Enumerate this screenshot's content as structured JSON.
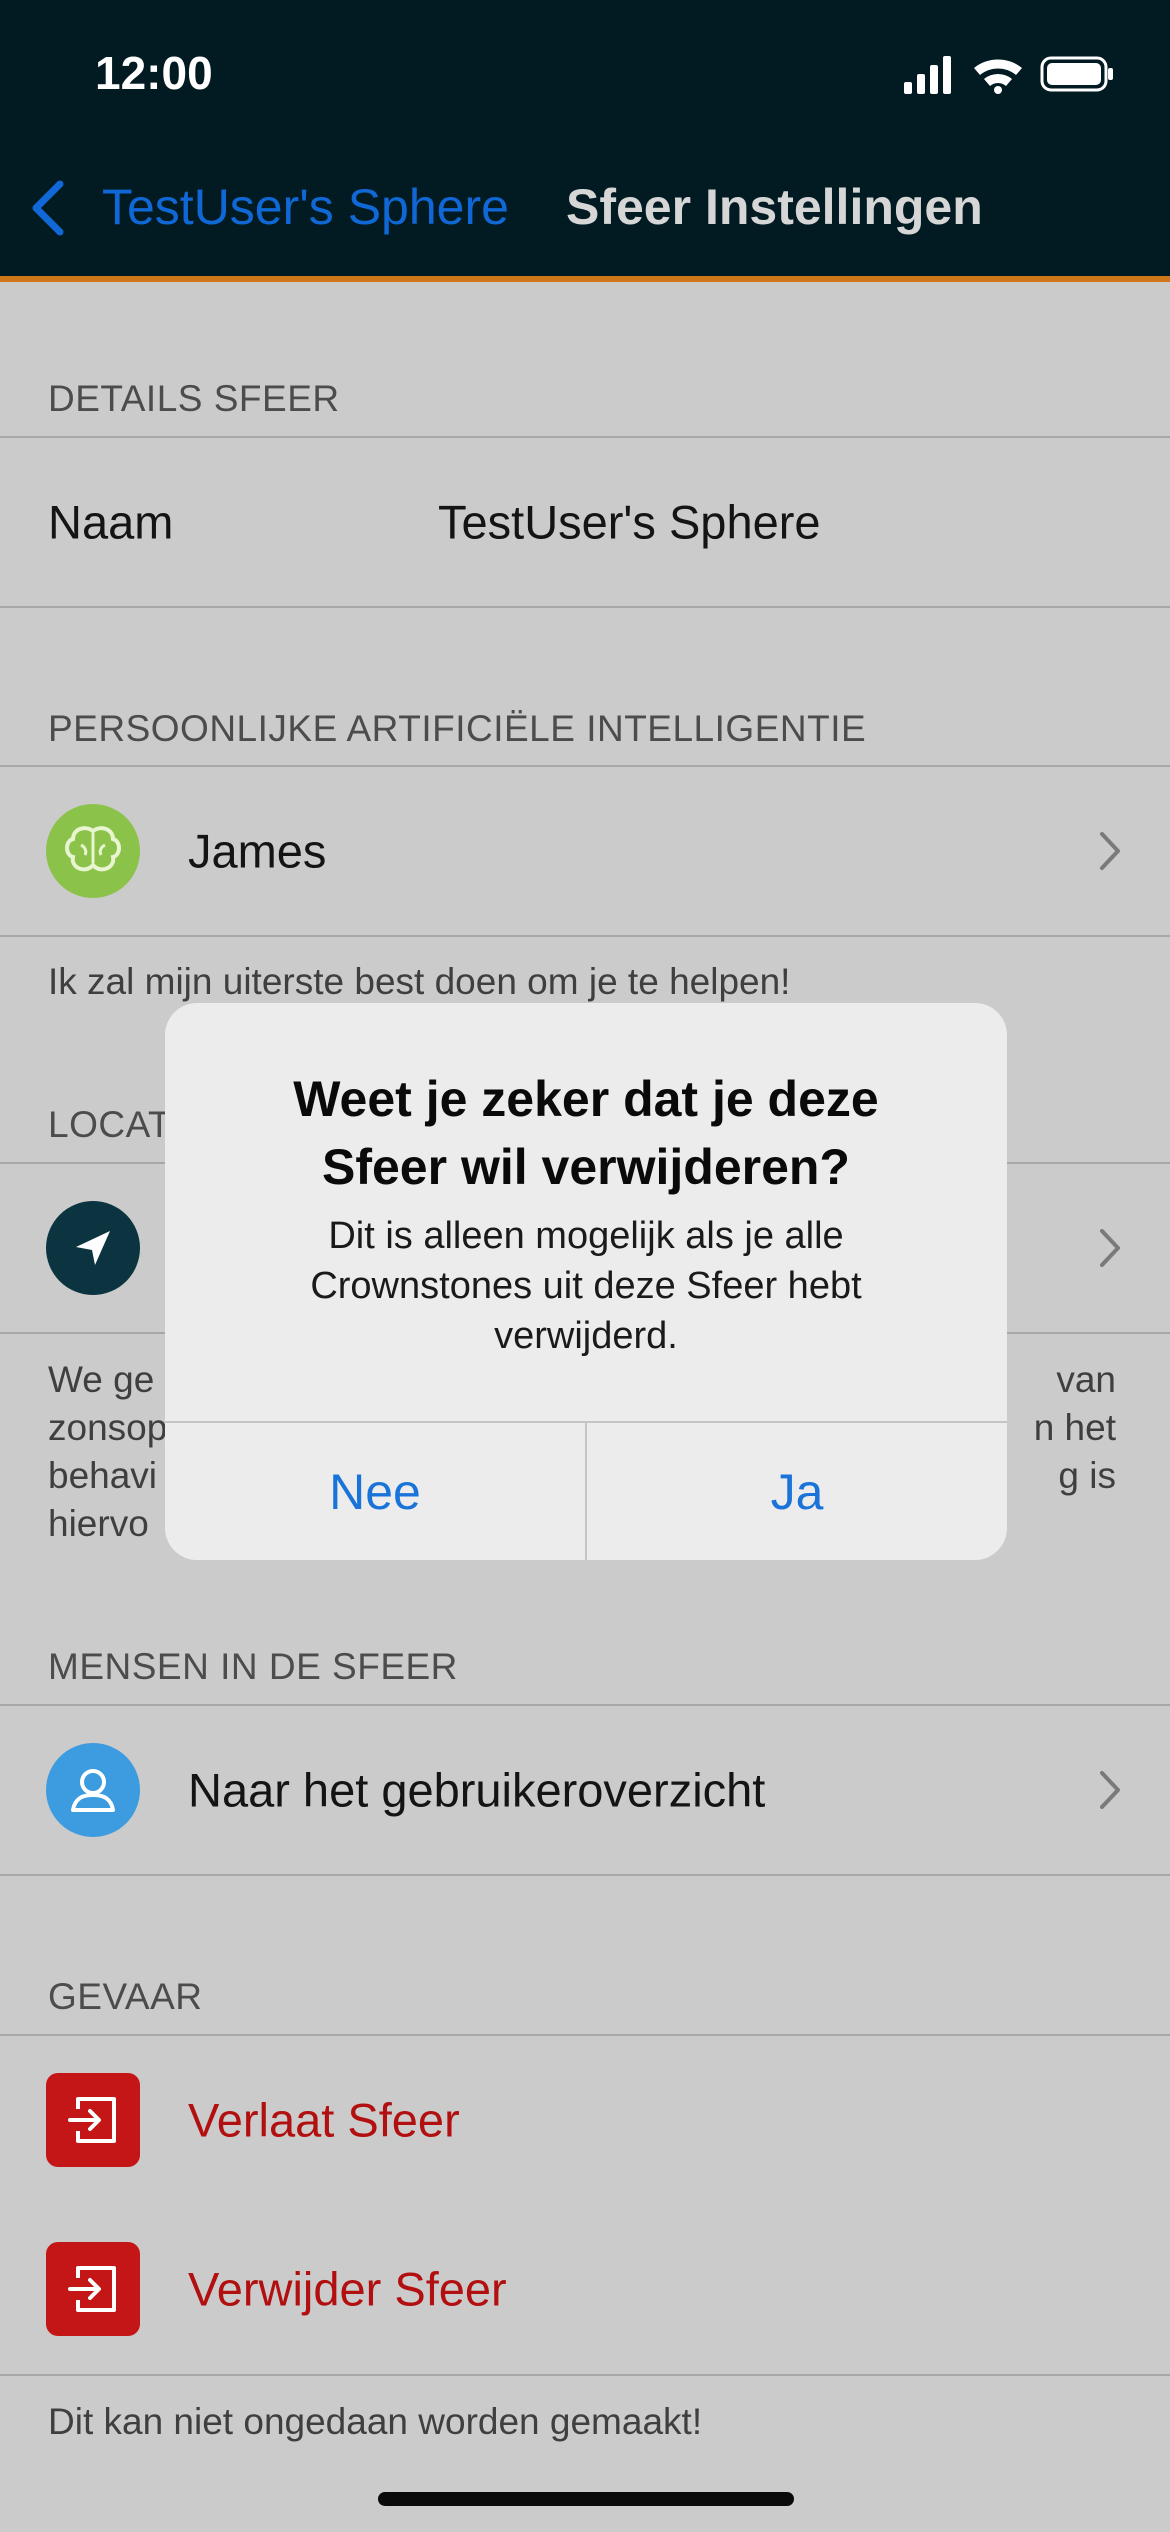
{
  "status_bar": {
    "time": "12:00"
  },
  "nav": {
    "back_label": "TestUser's Sphere",
    "title": "Sfeer Instellingen"
  },
  "details": {
    "header": "DETAILS SFEER",
    "name_label": "Naam",
    "name_value": "TestUser's Sphere"
  },
  "ai": {
    "header": "PERSOONLIJKE ARTIFICIËLE INTELLIGENTIE",
    "name": "James",
    "footer": "Ik zal mijn uiterste best doen om je te helpen!",
    "icon_color": "#8bc34a"
  },
  "location": {
    "header_visible": "LOCAT",
    "footer_lines_left": [
      "We ge",
      "zonsop",
      "behavi",
      "hiervo"
    ],
    "footer_lines_right": [
      "van",
      "n het",
      "g is"
    ],
    "icon_color": "#0b3340"
  },
  "people": {
    "header": "MENSEN IN DE SFEER",
    "item": "Naar het gebruikeroverzicht",
    "icon_color": "#3d9be0"
  },
  "danger": {
    "header": "GEVAAR",
    "leave": "Verlaat Sfeer",
    "delete": "Verwijder Sfeer",
    "footer": "Dit kan niet ongedaan worden gemaakt!",
    "icon_color": "#c41616"
  },
  "alert": {
    "title": "Weet je zeker dat je deze Sfeer wil verwijderen?",
    "message": "Dit is alleen mogelijk als je alle Crownstones uit deze Sfeer hebt verwijderd.",
    "cancel": "Nee",
    "confirm": "Ja"
  }
}
